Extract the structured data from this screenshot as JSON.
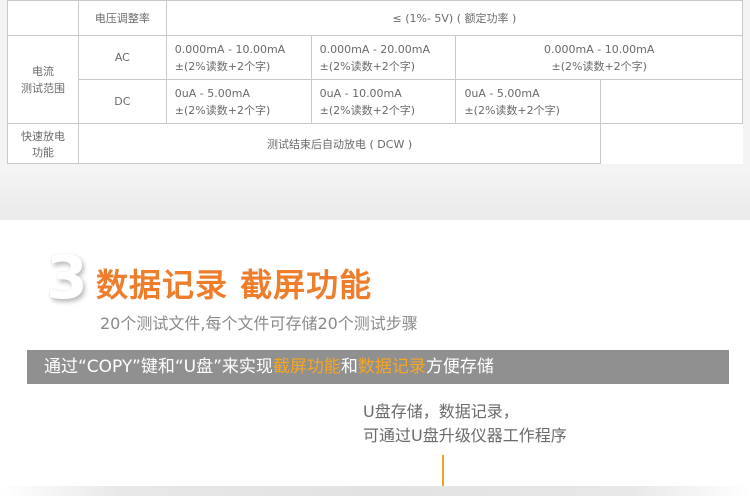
{
  "table": {
    "voltage_regulation": {
      "label": "电压调整率",
      "value": "≤ (1%- 5V) ( 额定功率 )"
    },
    "current_range": {
      "group_label_line1": "电流",
      "group_label_line2": "测试范围",
      "ac": {
        "label": "AC",
        "cells": [
          {
            "range": "0.000mA - 10.00mA",
            "accuracy": "±(2%读数+2个字)"
          },
          {
            "range": "0.000mA - 20.00mA",
            "accuracy": "±(2%读数+2个字)"
          },
          {
            "range": "0.000mA - 10.00mA",
            "accuracy": "±(2%读数+2个字)"
          }
        ]
      },
      "dc": {
        "label": "DC",
        "cells": [
          {
            "range": "0uA - 5.00mA",
            "accuracy": "±(2%读数+2个字)"
          },
          {
            "range": "0uA - 10.00mA",
            "accuracy": "±(2%读数+2个字)"
          },
          {
            "range": "0uA - 5.00mA",
            "accuracy": "±(2%读数+2个字)"
          }
        ]
      }
    },
    "fast_discharge": {
      "label": "快速放电功能",
      "value": "测试结束后自动放电 ( DCW )"
    }
  },
  "section": {
    "number": "3",
    "title": "数据记录 截屏功能",
    "subtitle": "20个测试文件,每个文件可存储20个测试步骤"
  },
  "banner": {
    "part1": "通过“COPY”键和“U盘”来实现",
    "highlight1": "截屏功能",
    "part2": "和",
    "highlight2": "数据记录",
    "part3": "方便存储"
  },
  "note": {
    "line1": "U盘存储，数据记录，",
    "line2": "可通过U盘升级仪器工作程序"
  },
  "colors": {
    "accent_orange": "#ee7d2c",
    "highlight_yellow": "#f5a623",
    "banner_gray": "#909090"
  }
}
